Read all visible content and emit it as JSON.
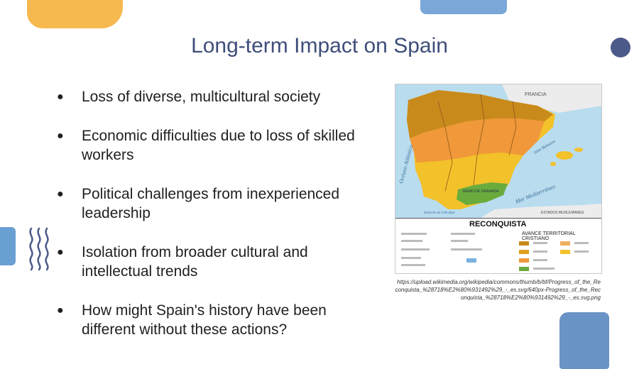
{
  "slide": {
    "title": "Long-term Impact on Spain",
    "bullets": [
      {
        "text": "Loss of diverse, multicultural society"
      },
      {
        "text": "Economic difficulties due to loss of skilled workers"
      },
      {
        "text": "Political challenges from inexperienced leadership"
      },
      {
        "text": "Isolation from broader cultural and intellectual trends"
      },
      {
        "text": "How might Spain's history have been different without these actions?"
      }
    ],
    "bullet_glyph": "●"
  },
  "map": {
    "label_francia": "FRANCIA",
    "label_oceano": "Océano Atlántico",
    "label_mar": "Mar Mediterráneo",
    "label_islas": "Islas Baleares",
    "label_granada": "REINO DE GRANADA",
    "label_estrecho": "Estrecho de Gibraltar",
    "label_estados": "ESTADOS MUSULMANES",
    "legend_title": "RECONQUISTA",
    "legend_subtitle": "AVANCE TERRITORIAL CRISTIANO"
  },
  "colors": {
    "title": "#3f4d7a",
    "deco_yellow": "#f6b94f",
    "deco_blue": "#6a93c6",
    "deco_navy": "#4c5a8a",
    "sea": "#b9dcef",
    "granada_green": "#6aab3e"
  },
  "source": {
    "text": "https://upload.wikimedia.org/wikipedia/commons/thumb/b/bf/Progress_of_the_Reconquista_%28718%E2%80%931492%29_-_es.svg/640px-Progress_of_the_Reconquista_%28718%E2%80%931492%29_-_es.svg.png"
  }
}
